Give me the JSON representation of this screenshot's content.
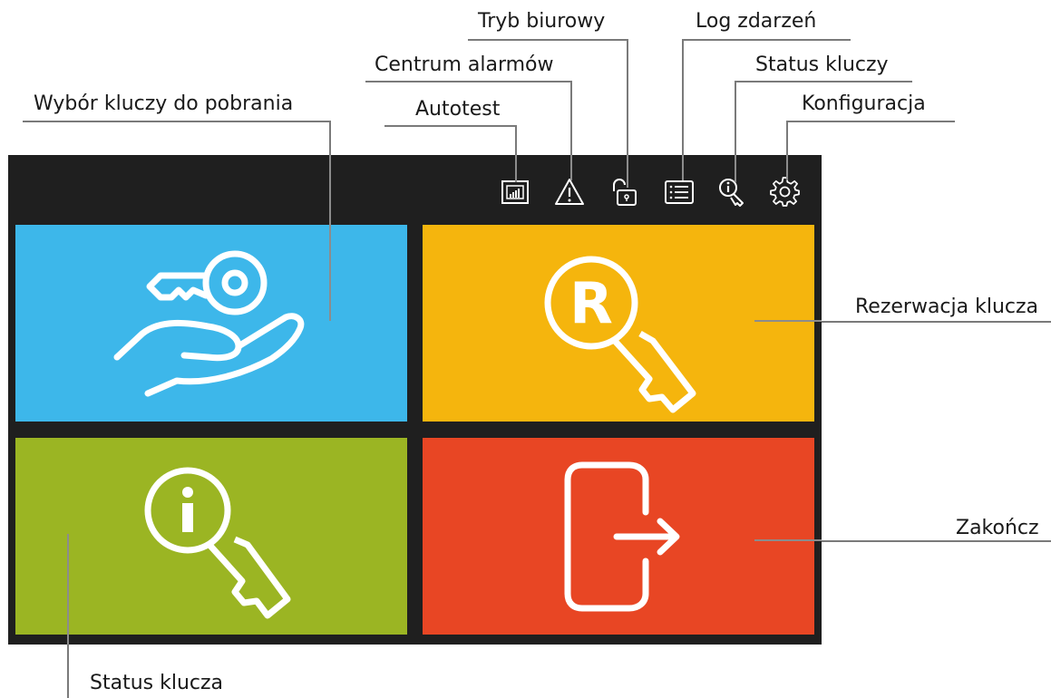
{
  "callouts": {
    "tryb_biurowy": "Tryb biurowy",
    "log_zdarzen": "Log zdarzeń",
    "centrum_alarmow": "Centrum alarmów",
    "status_kluczy": "Status kluczy",
    "wybor_kluczy": "Wybór kluczy do pobrania",
    "autotest": "Autotest",
    "konfiguracja": "Konfiguracja",
    "rezerwacja_klucza": "Rezerwacja klucza",
    "zakoncz": "Zakończ",
    "status_klucza": "Status klucza"
  },
  "toolbar_icons": [
    "autotest-icon",
    "alarm-warning-icon",
    "office-mode-lock-icon",
    "event-log-list-icon",
    "key-status-icon",
    "settings-gear-icon"
  ],
  "tiles": [
    {
      "name": "key-pickup-tile",
      "color": "#3db7ea",
      "icon": "hand-key-icon"
    },
    {
      "name": "key-reservation-tile",
      "color": "#f5b50d",
      "icon": "reservation-key-icon"
    },
    {
      "name": "key-status-tile",
      "color": "#9bb523",
      "icon": "info-key-icon"
    },
    {
      "name": "finish-tile",
      "color": "#e84624",
      "icon": "exit-door-icon"
    }
  ],
  "colors": {
    "screen_bg": "#1f1f1f",
    "icon_stroke": "#ffffff",
    "callout_line": "#7a7a7a"
  }
}
